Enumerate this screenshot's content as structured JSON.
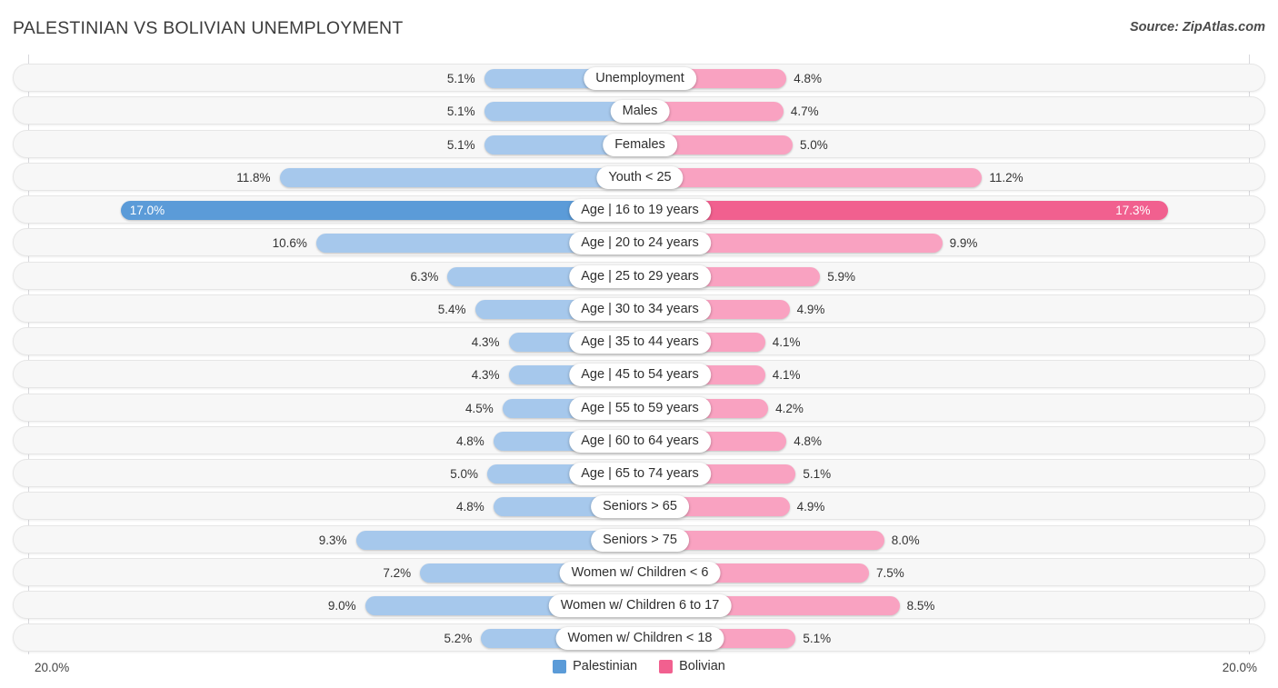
{
  "header": {
    "title": "PALESTINIAN VS BOLIVIAN UNEMPLOYMENT",
    "source": "Source: ZipAtlas.com"
  },
  "axis": {
    "min_label": "20.0%",
    "max_label": "20.0%",
    "max_value": 20.0
  },
  "legend": [
    {
      "label": "Palestinian",
      "color": "#5b9bd8"
    },
    {
      "label": "Bolivian",
      "color": "#f1608f"
    }
  ],
  "colors": {
    "left_normal": "#a6c8ec",
    "left_highlight": "#5b9bd8",
    "right_normal": "#f9a2c1",
    "right_highlight": "#f1608f",
    "track": "#f7f7f7"
  },
  "chart_data": {
    "type": "bar",
    "title": "PALESTINIAN VS BOLIVIAN UNEMPLOYMENT",
    "subtitle": "",
    "xlabel": "",
    "ylabel": "",
    "orientation": "horizontal-diverging",
    "xlim": [
      -20.0,
      20.0
    ],
    "grid": false,
    "legend_position": "bottom-center",
    "categories": [
      "Unemployment",
      "Males",
      "Females",
      "Youth < 25",
      "Age | 16 to 19 years",
      "Age | 20 to 24 years",
      "Age | 25 to 29 years",
      "Age | 30 to 34 years",
      "Age | 35 to 44 years",
      "Age | 45 to 54 years",
      "Age | 55 to 59 years",
      "Age | 60 to 64 years",
      "Age | 65 to 74 years",
      "Seniors > 65",
      "Seniors > 75",
      "Women w/ Children < 6",
      "Women w/ Children 6 to 17",
      "Women w/ Children < 18"
    ],
    "series": [
      {
        "name": "Palestinian",
        "color": "#5b9bd8",
        "side": "left",
        "values": [
          5.1,
          5.1,
          5.1,
          11.8,
          17.0,
          10.6,
          6.3,
          5.4,
          4.3,
          4.3,
          4.5,
          4.8,
          5.0,
          4.8,
          9.3,
          7.2,
          9.0,
          5.2
        ],
        "labels": [
          "5.1%",
          "5.1%",
          "5.1%",
          "11.8%",
          "17.0%",
          "10.6%",
          "6.3%",
          "5.4%",
          "4.3%",
          "4.3%",
          "4.5%",
          "4.8%",
          "5.0%",
          "4.8%",
          "9.3%",
          "7.2%",
          "9.0%",
          "5.2%"
        ]
      },
      {
        "name": "Bolivian",
        "color": "#f1608f",
        "side": "right",
        "values": [
          4.8,
          4.7,
          5.0,
          11.2,
          17.3,
          9.9,
          5.9,
          4.9,
          4.1,
          4.1,
          4.2,
          4.8,
          5.1,
          4.9,
          8.0,
          7.5,
          8.5,
          5.1
        ],
        "labels": [
          "4.8%",
          "4.7%",
          "5.0%",
          "11.2%",
          "17.3%",
          "9.9%",
          "5.9%",
          "4.9%",
          "4.1%",
          "4.1%",
          "4.2%",
          "4.8%",
          "5.1%",
          "4.9%",
          "8.0%",
          "7.5%",
          "8.5%",
          "5.1%"
        ]
      }
    ],
    "highlighted_category": "Age | 16 to 19 years"
  }
}
